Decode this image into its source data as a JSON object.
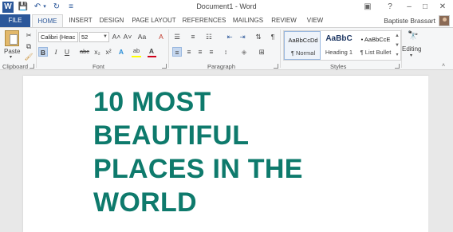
{
  "window": {
    "title": "Document1 - Word",
    "help": "?",
    "min": "–",
    "max": "□",
    "close": "✕",
    "options": "▣"
  },
  "quick_access": {
    "word_icon": "W",
    "save_icon": "💾",
    "undo_icon": "↶",
    "undo_arrow": "▾",
    "redo_icon": "↻",
    "customize_icon": "≡"
  },
  "tabs": [
    "FILE",
    "HOME",
    "INSERT",
    "DESIGN",
    "PAGE LAYOUT",
    "REFERENCES",
    "MAILINGS",
    "REVIEW",
    "VIEW"
  ],
  "user": {
    "name": "Baptiste Brassart"
  },
  "ribbon": {
    "clipboard": {
      "label": "Clipboard",
      "paste": "Paste",
      "paste_arrow": "▾"
    },
    "font": {
      "label": "Font",
      "family": "Calibri (Heac",
      "size": "52",
      "bold": "B",
      "italic": "I",
      "underline": "U",
      "strike": "abc",
      "subscript": "x₂",
      "superscript": "x²",
      "grow": "A˄",
      "shrink": "A˅",
      "case": "Aa",
      "clear": "A",
      "effects": "A",
      "highlight": "ab",
      "color": "A"
    },
    "paragraph": {
      "label": "Paragraph",
      "pilcrow": "¶"
    },
    "styles": {
      "label": "Styles",
      "items": [
        {
          "preview": "AaBbCcDd",
          "name": "¶ Normal"
        },
        {
          "preview": "AaBbC",
          "name": "Heading 1"
        },
        {
          "preview": "• AaBbCcE",
          "name": "¶ List Bullet"
        }
      ]
    },
    "editing": {
      "label": "Editing",
      "icon": "🔭"
    }
  },
  "document": {
    "heading_lines": [
      "10 MOST",
      "BEAUTIFUL",
      "PLACES IN THE",
      "WORLD"
    ]
  },
  "colors": {
    "accent": "#2b579a",
    "heading": "#0e7a6c",
    "font_color_bar": "#d0021b",
    "highlight_bar": "#ffff00"
  }
}
